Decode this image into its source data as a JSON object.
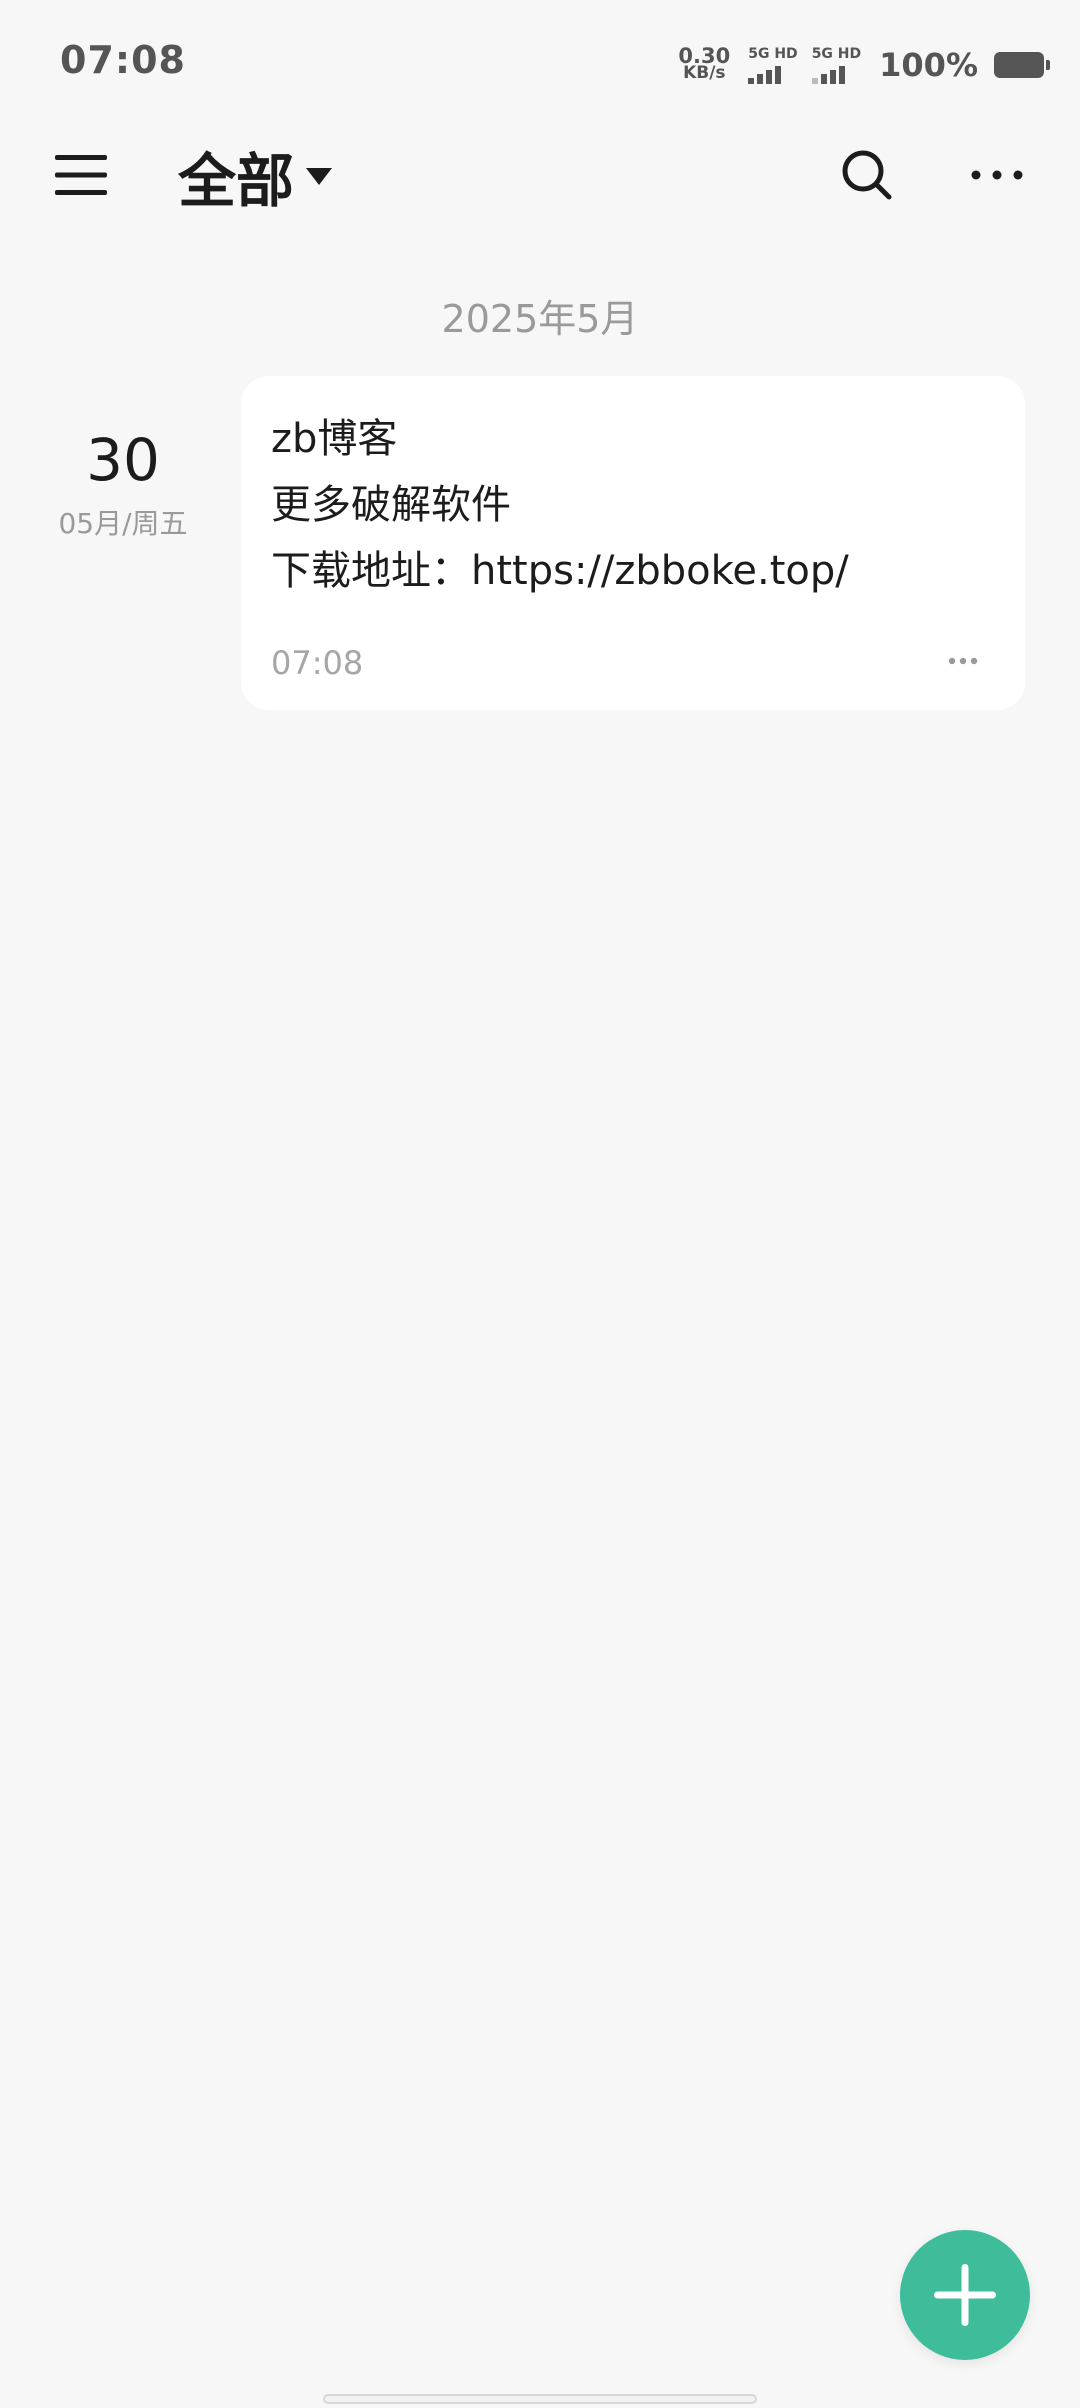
{
  "status_bar": {
    "time": "07:08",
    "net_speed_value": "0.30",
    "net_speed_unit": "KB/s",
    "sim1_label": "5G HD",
    "sim2_label": "5G HD",
    "battery_pct": "100%",
    "battery_level": 1.0
  },
  "toolbar": {
    "menu_icon": "hamburger-menu-icon",
    "folder_title": "全部",
    "dropdown_icon": "caret-down-icon",
    "search_icon": "search-icon",
    "more_icon": "more-horizontal-icon"
  },
  "month_header": "2025年5月",
  "notes": [
    {
      "day": "30",
      "date_sub": "05月/周五",
      "lines": [
        "zb博客",
        "更多破解软件",
        "下载地址：https://zbboke.top/"
      ],
      "time": "07:08",
      "more_icon": "more-horizontal-icon"
    }
  ],
  "fab": {
    "icon": "plus-icon"
  },
  "colors": {
    "background": "#f7f7f7",
    "card": "#ffffff",
    "accent": "#3fbd9b",
    "primary_text": "#1c1c1c",
    "secondary_text": "#9a9a9a"
  }
}
